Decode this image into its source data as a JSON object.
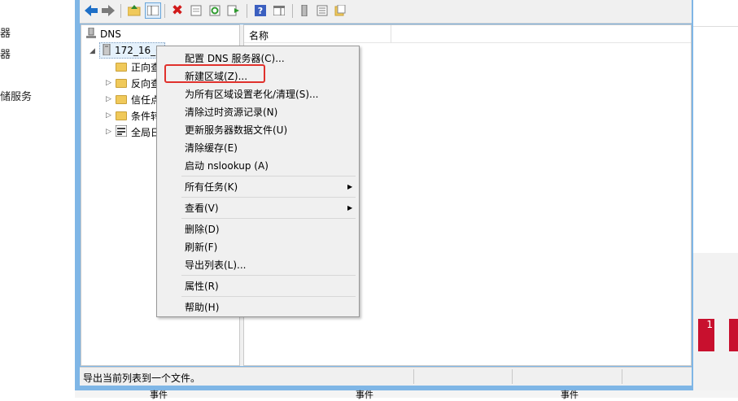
{
  "background_left": {
    "item1": "器",
    "item2": "器",
    "item3": "储服务"
  },
  "background_right": {
    "red_label": "1"
  },
  "bottom_strip": {
    "label1": "事件",
    "label2": "事件",
    "label3": "事件"
  },
  "toolbar": {
    "buttons": [
      "back-arrow",
      "forward-arrow",
      "up-folder",
      "show-hide-tree",
      "delete",
      "properties-sheet",
      "refresh",
      "export-list",
      "help",
      "action-pane",
      "server",
      "list-view",
      "detail-view"
    ]
  },
  "tree": {
    "root": "DNS",
    "server": "172_16_0",
    "children": [
      "正向查",
      "反向查",
      "信任点",
      "条件转",
      "全局日"
    ]
  },
  "list": {
    "column_name": "名称"
  },
  "context_menu": {
    "items": [
      "配置 DNS 服务器(C)...",
      "新建区域(Z)...",
      "为所有区域设置老化/清理(S)...",
      "清除过时资源记录(N)",
      "更新服务器数据文件(U)",
      "清除缓存(E)",
      "启动 nslookup (A)",
      "所有任务(K)",
      "查看(V)",
      "删除(D)",
      "刷新(F)",
      "导出列表(L)...",
      "属性(R)",
      "帮助(H)"
    ],
    "highlighted_index": 1
  },
  "status_bar": {
    "text": "导出当前列表到一个文件。"
  },
  "colors": {
    "accent": "#7fb6e6",
    "highlight": "#e0312c",
    "red_tile": "#c8102e"
  }
}
